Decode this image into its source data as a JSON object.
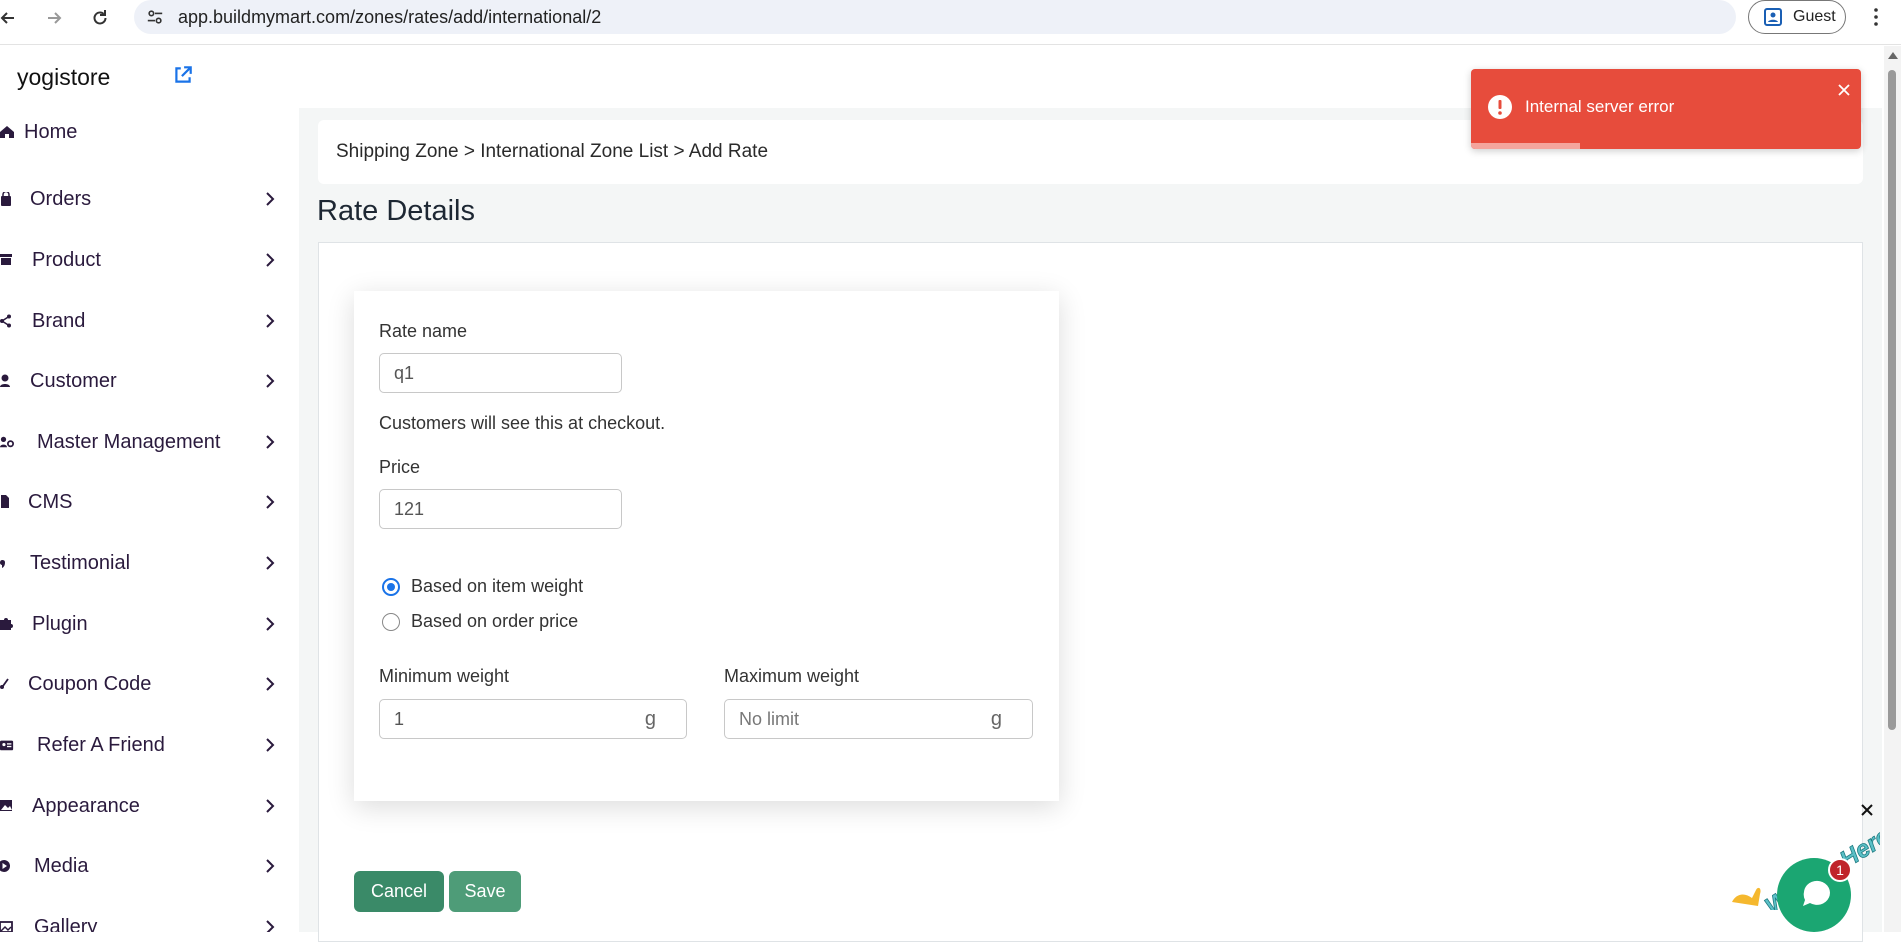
{
  "browser": {
    "url": "app.buildmymart.com/zones/rates/add/international/2",
    "profile_label": "Guest"
  },
  "sidebar": {
    "store_name": "yogistore",
    "items": [
      {
        "label": "Home",
        "icon": "home-icon"
      },
      {
        "label": "Orders",
        "icon": "bag-icon"
      },
      {
        "label": "Product",
        "icon": "box-icon"
      },
      {
        "label": "Brand",
        "icon": "share-icon"
      },
      {
        "label": "Customer",
        "icon": "user-icon"
      },
      {
        "label": "Master Management",
        "icon": "user-gear-icon"
      },
      {
        "label": "CMS",
        "icon": "file-icon"
      },
      {
        "label": "Testimonial",
        "icon": "quote-icon"
      },
      {
        "label": "Plugin",
        "icon": "puzzle-icon"
      },
      {
        "label": "Coupon Code",
        "icon": "scissors-icon"
      },
      {
        "label": "Refer A Friend",
        "icon": "id-card-icon"
      },
      {
        "label": "Appearance",
        "icon": "image-icon"
      },
      {
        "label": "Media",
        "icon": "play-icon"
      },
      {
        "label": "Gallery",
        "icon": "gallery-icon"
      }
    ]
  },
  "breadcrumb": "Shipping Zone > International Zone List > Add Rate",
  "page_title": "Rate Details",
  "form": {
    "rate_name_label": "Rate name",
    "rate_name_value": "q1",
    "helper_text": "Customers will see this at checkout.",
    "price_label": "Price",
    "price_value": "121",
    "radio_options": [
      {
        "label": "Based on item weight",
        "checked": true
      },
      {
        "label": "Based on order price",
        "checked": false
      }
    ],
    "min_weight_label": "Minimum weight",
    "min_weight_value": "1",
    "max_weight_label": "Maximum weight",
    "max_weight_placeholder": "No limit",
    "unit": "g"
  },
  "buttons": {
    "cancel": "Cancel",
    "save": "Save"
  },
  "toast": {
    "message": "Internal server error",
    "progress": 0.28,
    "color": "#e74c3c"
  },
  "chat_widget": {
    "banner_text": "We Are Here!",
    "badge_count": "1",
    "color": "#1ba672"
  }
}
